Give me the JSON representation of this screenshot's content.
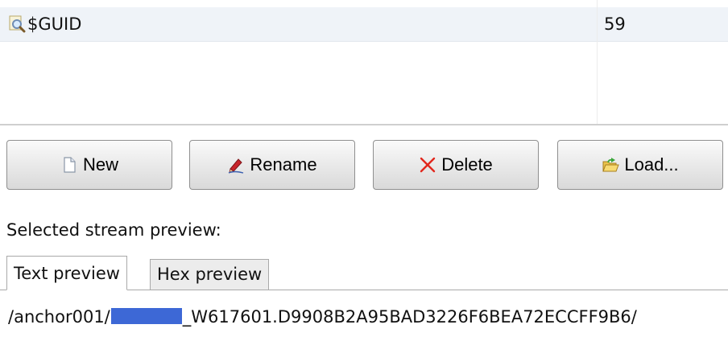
{
  "streams": {
    "rows": [
      {
        "name": "$GUID",
        "size": "59",
        "icon": "stream-search-icon"
      }
    ]
  },
  "toolbar": {
    "new_label": "New",
    "rename_label": "Rename",
    "delete_label": "Delete",
    "load_label": "Load..."
  },
  "preview": {
    "label": "Selected stream preview:",
    "tabs": [
      {
        "label": "Text preview",
        "selected": true
      },
      {
        "label": "Hex preview",
        "selected": false
      }
    ],
    "content_prefix": "/anchor001/",
    "content_suffix": "_W617601.D9908B2A95BAD3226F6BEA72ECCFF9B6/"
  },
  "colors": {
    "row_highlight": "#eff3f8",
    "redaction": "#3d68d6",
    "delete_icon": "#e2271d",
    "rename_icon": "#c8242b"
  }
}
